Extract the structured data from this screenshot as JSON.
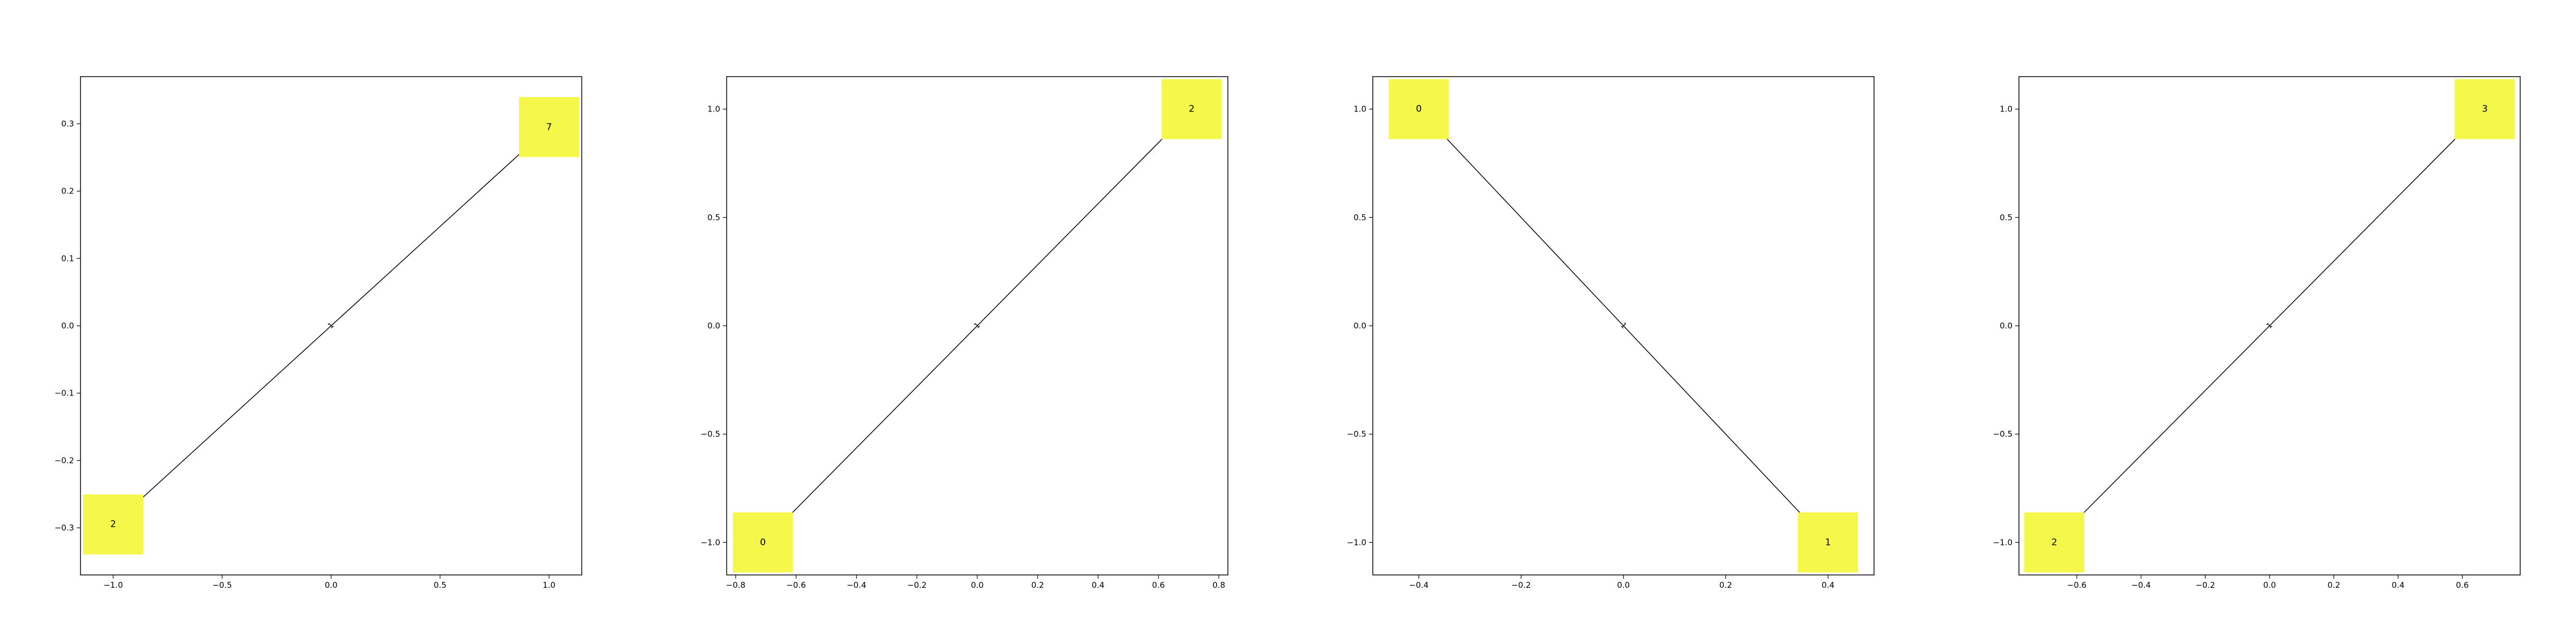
{
  "colors": {
    "node": "#f5f74a",
    "edge": "#000000",
    "frame": "#000000",
    "background": "#ffffff"
  },
  "chart_data": [
    {
      "type": "network",
      "xlim": [
        -1.15,
        1.15
      ],
      "ylim": [
        -0.37,
        0.37
      ],
      "xticks": [
        {
          "v": -1.0,
          "label": "−1.0"
        },
        {
          "v": -0.5,
          "label": "−0.5"
        },
        {
          "v": 0.0,
          "label": "0.0"
        },
        {
          "v": 0.5,
          "label": "0.5"
        },
        {
          "v": 1.0,
          "label": "1.0"
        }
      ],
      "yticks": [
        {
          "v": -0.3,
          "label": "−0.3"
        },
        {
          "v": -0.2,
          "label": "−0.2"
        },
        {
          "v": -0.1,
          "label": "−0.1"
        },
        {
          "v": 0.0,
          "label": "0.0"
        },
        {
          "v": 0.1,
          "label": "0.1"
        },
        {
          "v": 0.2,
          "label": "0.2"
        },
        {
          "v": 0.3,
          "label": "0.3"
        }
      ],
      "nodes": [
        {
          "label": "2",
          "x": -1.0,
          "y": -0.295
        },
        {
          "label": "7",
          "x": 1.0,
          "y": 0.295
        }
      ],
      "edges": [
        {
          "from": 0,
          "to": 1,
          "label": "1"
        }
      ]
    },
    {
      "type": "network",
      "xlim": [
        -0.83,
        0.83
      ],
      "ylim": [
        -1.15,
        1.15
      ],
      "xticks": [
        {
          "v": -0.8,
          "label": "−0.8"
        },
        {
          "v": -0.6,
          "label": "−0.6"
        },
        {
          "v": -0.4,
          "label": "−0.4"
        },
        {
          "v": -0.2,
          "label": "−0.2"
        },
        {
          "v": 0.0,
          "label": "0.0"
        },
        {
          "v": 0.2,
          "label": "0.2"
        },
        {
          "v": 0.4,
          "label": "0.4"
        },
        {
          "v": 0.6,
          "label": "0.6"
        },
        {
          "v": 0.8,
          "label": "0.8"
        }
      ],
      "yticks": [
        {
          "v": -1.0,
          "label": "−1.0"
        },
        {
          "v": -0.5,
          "label": "−0.5"
        },
        {
          "v": 0.0,
          "label": "0.0"
        },
        {
          "v": 0.5,
          "label": "0.5"
        },
        {
          "v": 1.0,
          "label": "1.0"
        }
      ],
      "nodes": [
        {
          "label": "0",
          "x": -0.71,
          "y": -1.0
        },
        {
          "label": "2",
          "x": 0.71,
          "y": 1.0
        }
      ],
      "edges": [
        {
          "from": 0,
          "to": 1,
          "label": "1"
        }
      ]
    },
    {
      "type": "network",
      "xlim": [
        -0.49,
        0.49
      ],
      "ylim": [
        -1.15,
        1.15
      ],
      "xticks": [
        {
          "v": -0.4,
          "label": "−0.4"
        },
        {
          "v": -0.2,
          "label": "−0.2"
        },
        {
          "v": 0.0,
          "label": "0.0"
        },
        {
          "v": 0.2,
          "label": "0.2"
        },
        {
          "v": 0.4,
          "label": "0.4"
        }
      ],
      "yticks": [
        {
          "v": -1.0,
          "label": "−1.0"
        },
        {
          "v": -0.5,
          "label": "−0.5"
        },
        {
          "v": 0.0,
          "label": "0.0"
        },
        {
          "v": 0.5,
          "label": "0.5"
        },
        {
          "v": 1.0,
          "label": "1.0"
        }
      ],
      "nodes": [
        {
          "label": "0",
          "x": -0.4,
          "y": 1.0
        },
        {
          "label": "1",
          "x": 0.4,
          "y": -1.0
        }
      ],
      "edges": [
        {
          "from": 0,
          "to": 1,
          "label": "1"
        }
      ]
    },
    {
      "type": "network",
      "xlim": [
        -0.78,
        0.78
      ],
      "ylim": [
        -1.15,
        1.15
      ],
      "xticks": [
        {
          "v": -0.6,
          "label": "−0.6"
        },
        {
          "v": -0.4,
          "label": "−0.4"
        },
        {
          "v": -0.2,
          "label": "−0.2"
        },
        {
          "v": 0.0,
          "label": "0.0"
        },
        {
          "v": 0.2,
          "label": "0.2"
        },
        {
          "v": 0.4,
          "label": "0.4"
        },
        {
          "v": 0.6,
          "label": "0.6"
        }
      ],
      "yticks": [
        {
          "v": -1.0,
          "label": "−1.0"
        },
        {
          "v": -0.5,
          "label": "−0.5"
        },
        {
          "v": 0.0,
          "label": "0.0"
        },
        {
          "v": 0.5,
          "label": "0.5"
        },
        {
          "v": 1.0,
          "label": "1.0"
        }
      ],
      "nodes": [
        {
          "label": "2",
          "x": -0.67,
          "y": -1.0
        },
        {
          "label": "3",
          "x": 0.67,
          "y": 1.0
        }
      ],
      "edges": [
        {
          "from": 0,
          "to": 1,
          "label": "1"
        }
      ]
    }
  ]
}
